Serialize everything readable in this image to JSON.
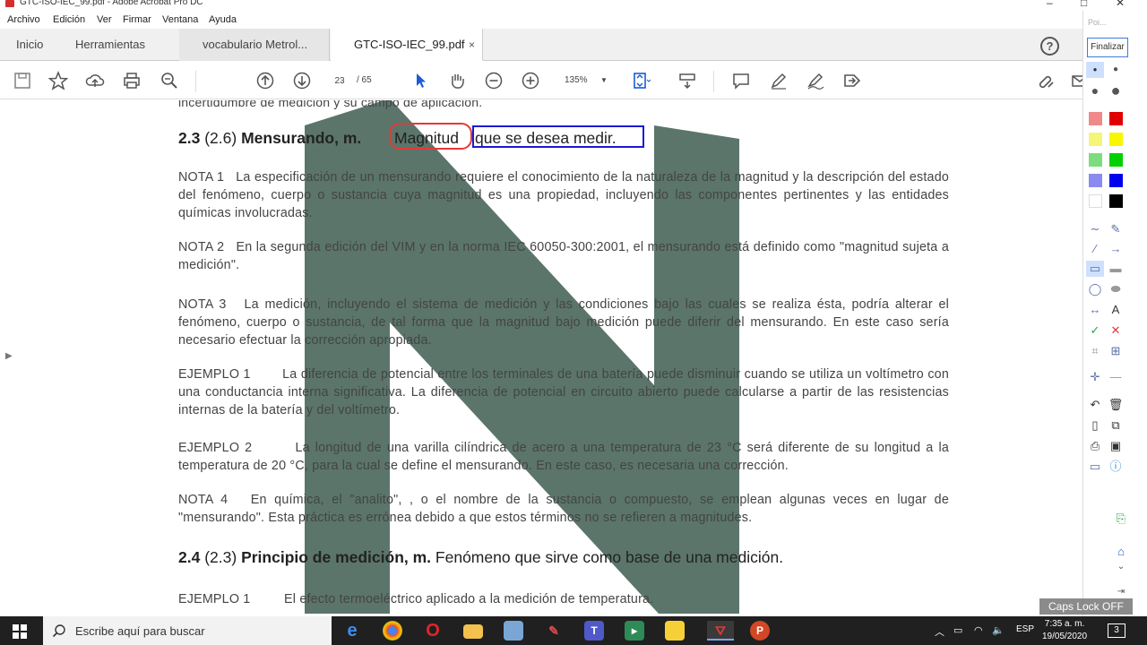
{
  "window": {
    "title": "GTC-ISO-IEC_99.pdf - Adobe Acrobat Pro DC",
    "controls": [
      "–",
      "□",
      "✕"
    ]
  },
  "menu": [
    "Archivo",
    "Edición",
    "Ver",
    "Firmar",
    "Ventana",
    "Ayuda"
  ],
  "tabs": {
    "home": "Inicio",
    "tools": "Herramientas",
    "docs": [
      {
        "label": "vocabulario Metrol..."
      },
      {
        "label": "GTC-ISO-IEC_99.pdf",
        "close": "×"
      }
    ]
  },
  "help_label": "?",
  "toolbar": {
    "page_current": "23",
    "page_total": "/  65",
    "zoom": "135%"
  },
  "document": {
    "top_fragment": "incertidumbre de medición y su campo de aplicación.",
    "heading1": {
      "num": "2.3",
      "ref": "(2.6)",
      "term": "Mensurando, m.",
      "def_word": "Magnitud",
      "def_rest": "que se desea medir."
    },
    "nota1_label": "NOTA 1",
    "nota1": "La especificación de un mensurando requiere el conocimiento de la naturaleza de la magnitud y la descripción del estado del fenómeno, cuerpo o sustancia cuya magnitud es una propiedad, incluyendo las componentes pertinentes y las entidades químicas involucradas.",
    "nota2_label": "NOTA 2",
    "nota2": "En la segunda edición del VIM y en la norma  IEC 60050-300:2001, el mensurando está definido como \"magnitud sujeta a medición\".",
    "nota3_label": "NOTA 3",
    "nota3": "La medición, incluyendo el sistema de medición y las condiciones bajo las cuales se realiza ésta, podría alterar el fenómeno, cuerpo o sustancia, de tal forma que la magnitud bajo medición puede diferir  del mensurando. En este caso sería necesario efectuar la corrección apropiada.",
    "ej1_label": "EJEMPLO 1",
    "ej1": "La diferencia de potencial entre los terminales de una batería puede disminuir cuando se utiliza un voltímetro con una conductancia interna significativa. La diferencia de potencial en circuito abierto puede calcularse a partir de las resistencias internas de la batería y del voltímetro.",
    "ej2_label": "EJEMPLO 2",
    "ej2": "La longitud de una varilla cilíndrica de acero a una temperatura de 23 °C será diferente de su longitud a la temperatura de 20 °C, para la cual se define el mensurando. En este caso, es necesaria una corrección.",
    "nota4_label": "NOTA 4",
    "nota4": "En química, el  \"analito\", , o el nombre de la sustancia o compuesto, se emplean algunas veces en lugar de \"mensurando\". Esta práctica es errónea debido a que estos términos no se refieren a magnitudes.",
    "heading2": {
      "num": "2.4",
      "ref": "(2.3)",
      "term": "Principio de medición, m.",
      "def": "Fenómeno que sirve como base de una medición."
    },
    "ej3_label": "EJEMPLO 1",
    "ej3": "El efecto termoeléctrico aplicado a la medición de temperatura."
  },
  "right_panel": {
    "poi": "Poi...",
    "finish": "Finalizar",
    "caps": "Caps Lock OFF"
  },
  "taskbar": {
    "search_placeholder": "Escribe aquí para buscar",
    "lang": "ESP",
    "time": "7:35 a. m.",
    "date": "19/05/2020",
    "notif_count": "3"
  },
  "colors": {
    "annotation_red": "#e53935",
    "annotation_blue": "#1a1ad4",
    "watermark": "#4f6b60",
    "acrobat_red": "#d32f2f"
  }
}
